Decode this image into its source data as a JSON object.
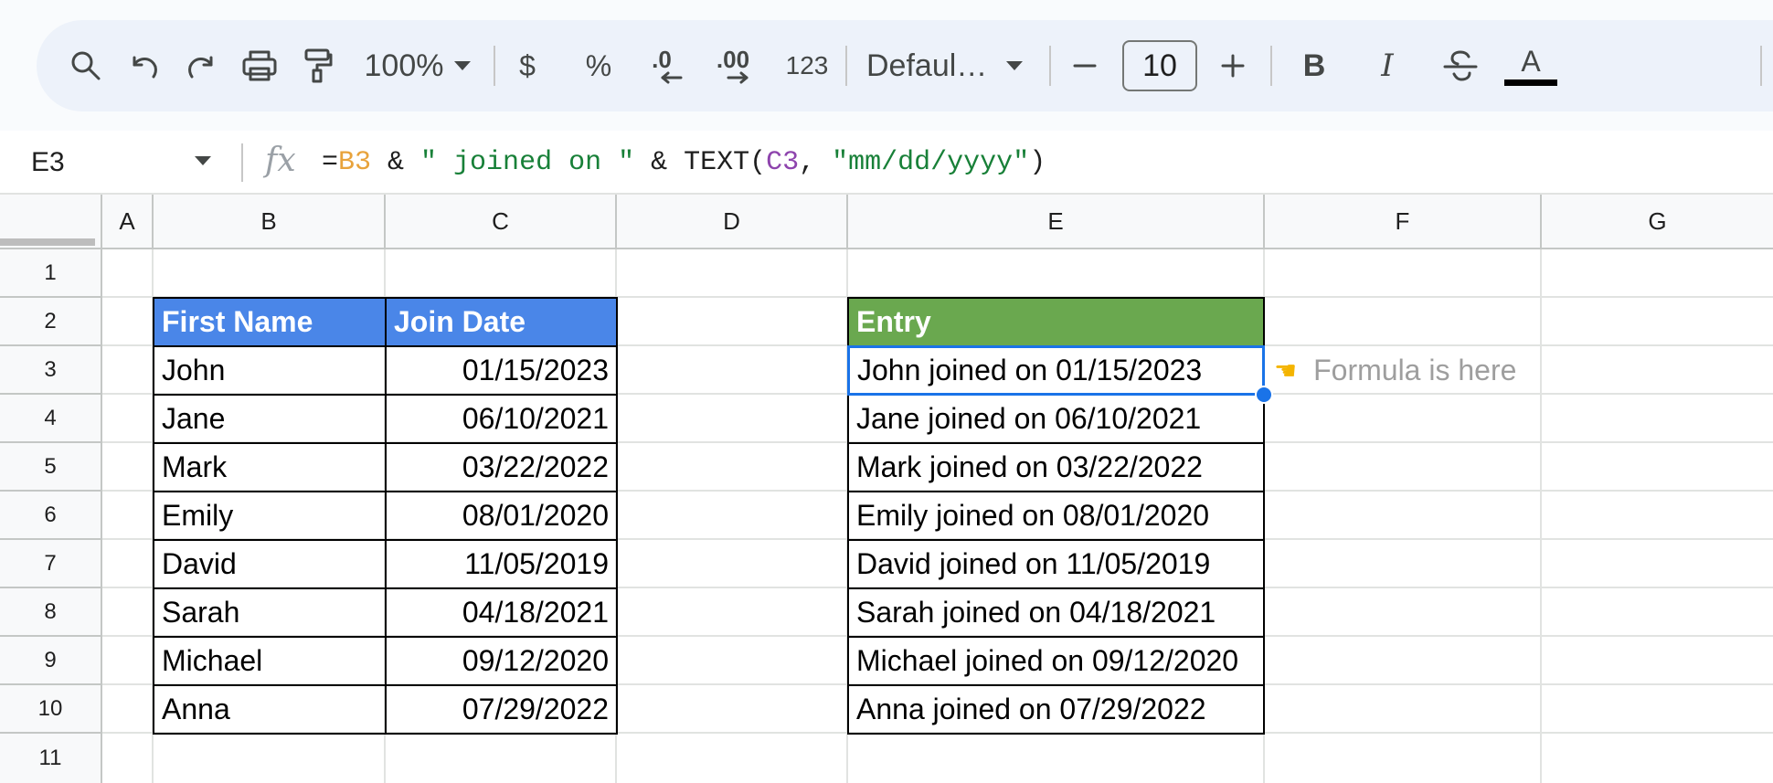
{
  "toolbar": {
    "zoom": "100%",
    "currency": "$",
    "percent": "%",
    "decrease_decimals": ".0",
    "increase_decimals": ".00",
    "number_format": "123",
    "font_name": "Defaul…",
    "font_size": "10",
    "minus": "–",
    "plus": "+",
    "bold": "B",
    "italic": "I",
    "text_color": "A"
  },
  "formula_bar": {
    "cell_ref": "E3",
    "fx": "fx",
    "formula_parts": {
      "eq": "=",
      "ref1": "B3",
      "amp1": " & ",
      "str1": "\" joined on \"",
      "amp2": " & TEXT(",
      "ref2": "C3",
      "comma": ", ",
      "str2": "\"mm/dd/yyyy\"",
      "close": ")"
    }
  },
  "columns": [
    "A",
    "B",
    "C",
    "D",
    "E",
    "F",
    "G"
  ],
  "rows": [
    "1",
    "2",
    "3",
    "4",
    "5",
    "6",
    "7",
    "8",
    "9",
    "10",
    "11"
  ],
  "table1": {
    "header_name": "First Name",
    "header_date": "Join Date",
    "header_color": "#4a86e8",
    "rows": [
      {
        "name": "John",
        "date": "01/15/2023"
      },
      {
        "name": "Jane",
        "date": "06/10/2021"
      },
      {
        "name": "Mark",
        "date": "03/22/2022"
      },
      {
        "name": "Emily",
        "date": "08/01/2020"
      },
      {
        "name": "David",
        "date": "11/05/2019"
      },
      {
        "name": "Sarah",
        "date": "04/18/2021"
      },
      {
        "name": "Michael",
        "date": "09/12/2020"
      },
      {
        "name": "Anna",
        "date": "07/29/2022"
      }
    ]
  },
  "table2": {
    "header": "Entry",
    "header_color": "#6aa84f",
    "rows": [
      "John joined on 01/15/2023",
      "Jane joined on 06/10/2021",
      "Mark joined on 03/22/2022",
      "Emily joined on 08/01/2020",
      "David joined on 11/05/2019",
      "Sarah joined on 04/18/2021",
      "Michael joined on 09/12/2020",
      "Anna joined on 07/29/2022"
    ]
  },
  "annotation": {
    "icon": "pointing-hand-icon",
    "text": "Formula is here"
  },
  "selection_color": "#1a73e8"
}
